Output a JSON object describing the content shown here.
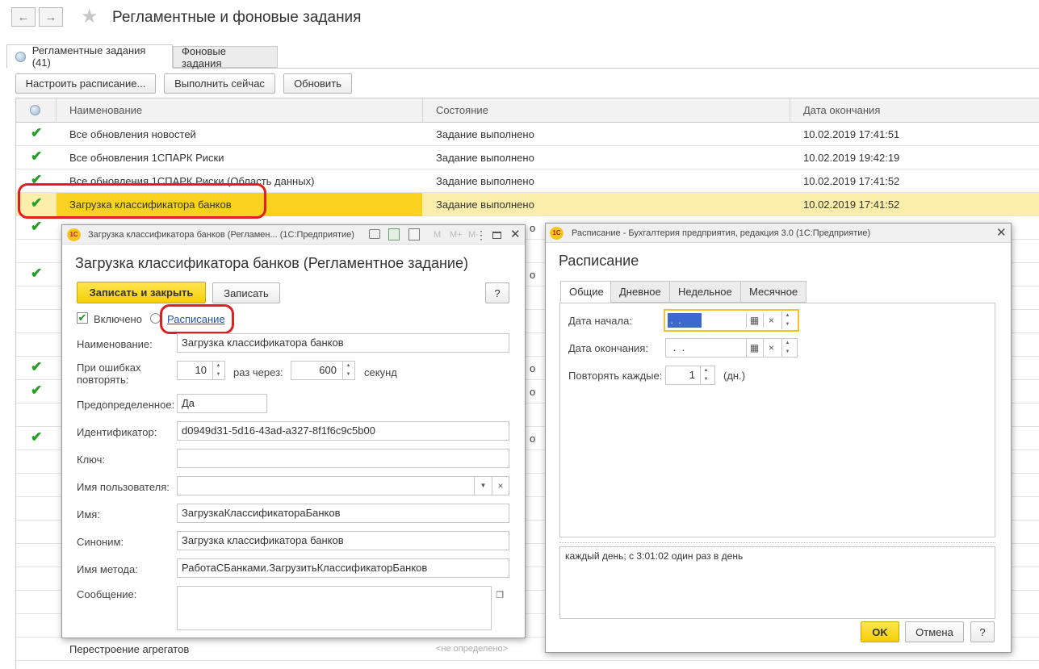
{
  "header": {
    "back_icon": "←",
    "forward_icon": "→",
    "star_icon": "★",
    "title": "Регламентные и фоновые задания"
  },
  "tabs": [
    {
      "label": "Регламентные задания (41)"
    },
    {
      "label": "Фоновые задания"
    }
  ],
  "toolbar": {
    "configure": "Настроить расписание...",
    "run_now": "Выполнить сейчас",
    "refresh": "Обновить"
  },
  "table": {
    "columns": [
      "Наименование",
      "Состояние",
      "Дата окончания"
    ],
    "rows": [
      {
        "name": "Все обновления новостей",
        "state": "Задание выполнено",
        "date": "10.02.2019 17:41:51",
        "check": "✔"
      },
      {
        "name": "Все обновления 1СПАРК Риски",
        "state": "Задание выполнено",
        "date": "10.02.2019 19:42:19",
        "check": "✔"
      },
      {
        "name": "Все обновления 1СПАРК Риски (Область данных)",
        "state": "Задание выполнено",
        "date": "10.02.2019 17:41:52",
        "check": "✔"
      },
      {
        "name": "Загрузка классификатора банков",
        "state": "Задание выполнено",
        "date": "10.02.2019 17:41:52",
        "check": "✔"
      }
    ],
    "partial_state": "о",
    "last_row_name": "Перестроение агрегатов",
    "last_row_state": "<не определено>"
  },
  "job_dialog": {
    "title_bar": "Загрузка классификатора банков (Регламен...  (1С:Предприятие)",
    "heading": "Загрузка классификатора банков (Регламентное задание)",
    "save_close": "Записать и закрыть",
    "save": "Записать",
    "help": "?",
    "enabled_label": "Включено",
    "schedule_link": "Расписание",
    "name_label": "Наименование:",
    "name_value": "Загрузка классификатора банков",
    "retry_label_1": "При ошибках",
    "retry_label_2": "повторять:",
    "retry_count": "10",
    "times_label": "раз  через:",
    "retry_interval": "600",
    "seconds_label": "секунд",
    "predefined_label": "Предопределенное:",
    "predefined_value": "Да",
    "id_label": "Идентификатор:",
    "id_value": "d0949d31-5d16-43ad-a327-8f1f6c9c5b00",
    "key_label": "Ключ:",
    "key_value": "",
    "user_label": "Имя пользователя:",
    "user_value": "",
    "iname_label": "Имя:",
    "iname_value": "ЗагрузкаКлассификатораБанков",
    "synonym_label": "Синоним:",
    "synonym_value": "Загрузка классификатора банков",
    "method_label": "Имя метода:",
    "method_value": "РаботаСБанками.ЗагрузитьКлассификаторБанков",
    "message_label": "Сообщение:",
    "message_value": ""
  },
  "schedule_dialog": {
    "title_bar": "Расписание - Бухгалтерия предприятия, редакция 3.0  (1С:Предприятие)",
    "heading": "Расписание",
    "tabs": [
      "Общие",
      "Дневное",
      "Недельное",
      "Месячное"
    ],
    "start_label": "Дата начала:",
    "start_value": " .  .",
    "end_label": "Дата окончания:",
    "end_value": " .  .",
    "repeat_label": "Повторять каждые:",
    "repeat_value": "1",
    "days_label": "(дн.)",
    "summary": "каждый день; с 3:01:02 один раз в день",
    "ok": "OK",
    "cancel": "Отмена",
    "help": "?"
  }
}
